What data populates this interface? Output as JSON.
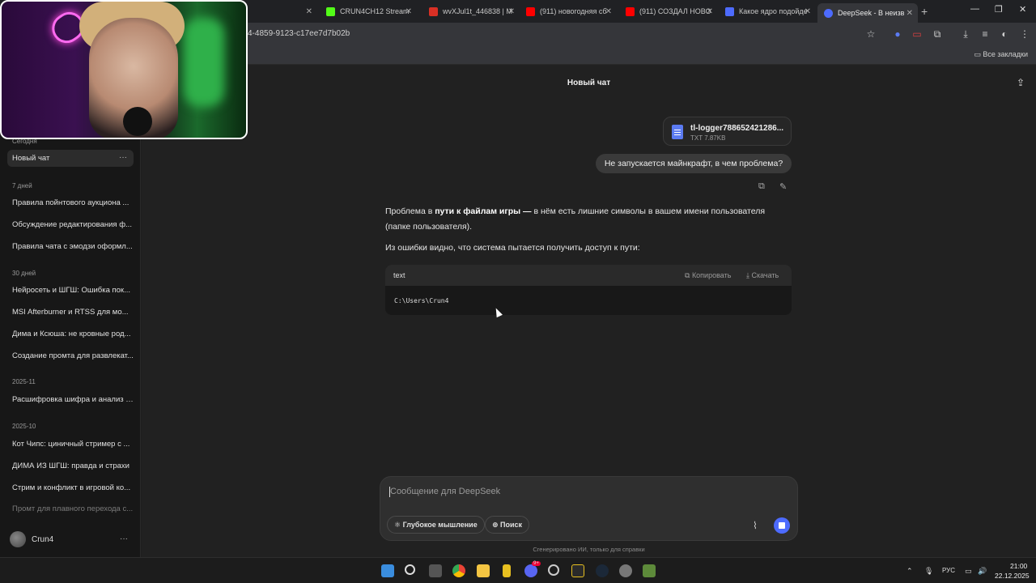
{
  "browser": {
    "tabs": [
      {
        "label": "",
        "color": "#888888"
      },
      {
        "label": "CRUN4CH12 Stream",
        "color": "#53fc18"
      },
      {
        "label": "wvXJul1t_446838 | M",
        "color": "#d93025"
      },
      {
        "label": "(911) новогодняя сб",
        "color": "#ff0000"
      },
      {
        "label": "(911) СОЗДАЛ НОВО",
        "color": "#ff0000"
      },
      {
        "label": "Какое ядро подойде",
        "color": "#4d6bfe"
      },
      {
        "label": "DeepSeek - В неизв",
        "color": "#4d6bfe"
      }
    ],
    "url": "4-4859-9123-c17ee7d7b02b",
    "bookmarks_all": "Все закладки"
  },
  "sidebar": {
    "sections": [
      {
        "title": "Сегодня",
        "items": [
          {
            "label": "Новый чат",
            "active": true
          }
        ]
      },
      {
        "title": "7 дней",
        "items": [
          {
            "label": "Правила пойнтового аукциона ..."
          },
          {
            "label": "Обсуждение редактирования ф..."
          },
          {
            "label": "Правила чата с эмодзи оформл..."
          }
        ]
      },
      {
        "title": "30 дней",
        "items": [
          {
            "label": "Нейросеть и ШГШ: Ошибка пок..."
          },
          {
            "label": "MSI Afterburner и RTSS для мо..."
          },
          {
            "label": "Дима и Ксюша: не кровные род..."
          },
          {
            "label": "Создание промта для развлекат..."
          }
        ]
      },
      {
        "title": "2025-11",
        "items": [
          {
            "label": "Расшифровка шифра и анализ т..."
          }
        ]
      },
      {
        "title": "2025-10",
        "items": [
          {
            "label": "Кот Чипс: циничный стример с ..."
          },
          {
            "label": "ДИМА ИЗ ШГШ: правда и страхи"
          },
          {
            "label": "Стрим и конфликт в игровой ко..."
          },
          {
            "label": "Промт для плавного перехода с..."
          }
        ]
      }
    ],
    "more": "···",
    "user_name": "Crun4"
  },
  "chat": {
    "title": "Новый чат",
    "file": {
      "name": "tl-logger788652421286...",
      "meta": "TXT 7.87KB"
    },
    "user_message": "Не запускается майнкрафт, в чем проблема?",
    "assistant": {
      "p1_a": "Проблема в ",
      "p1_bold": "пути к файлам игры —",
      "p1_b": " в нём есть лишние символы в вашем имени пользователя (папке пользователя).",
      "p2": "Из ошибки видно, что система пытается получить доступ к пути:",
      "code_lang": "text",
      "code_copy": "Копировать",
      "code_download": "Скачать",
      "code": "C:\\Users\\Crun4"
    }
  },
  "composer": {
    "placeholder": "Сообщение для DeepSeek",
    "deep_thinking": "Глубокое мышление",
    "search": "Поиск",
    "disclaimer": "Сгенерировано ИИ, только для справки"
  },
  "taskbar": {
    "lang": "РУС",
    "time": "21:00",
    "date": "22.12.2025",
    "discord_badge": "9+"
  },
  "colors": {
    "accent": "#4d6bfe",
    "bg": "#212121",
    "sidebar": "#171717"
  }
}
